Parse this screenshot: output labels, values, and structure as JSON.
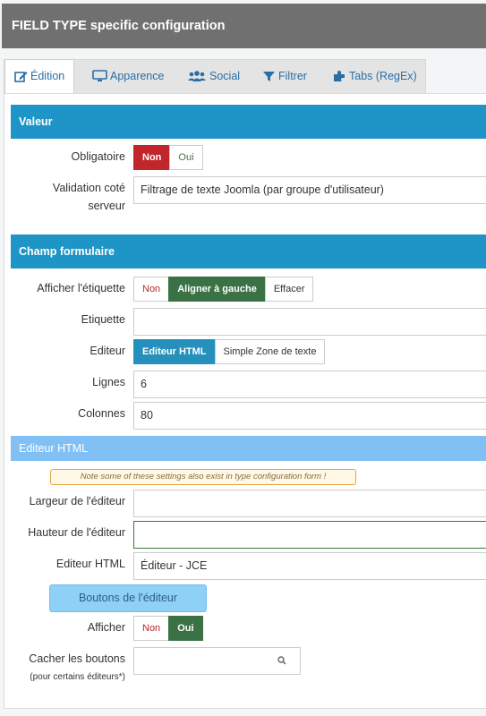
{
  "header": {
    "title": "FIELD TYPE specific configuration"
  },
  "tabs": [
    {
      "label": "Édition",
      "icon": "edit-icon",
      "active": true
    },
    {
      "label": "Apparence",
      "icon": "monitor-icon"
    },
    {
      "label": "Social",
      "icon": "users-icon"
    },
    {
      "label": "Filtrer",
      "icon": "filter-icon"
    },
    {
      "label": "Tabs (RegEx)",
      "icon": "puzzle-icon"
    }
  ],
  "valeur": {
    "title": "Valeur",
    "obligatoire": {
      "label": "Obligatoire",
      "options": [
        "Non",
        "Oui"
      ],
      "selected": "Non"
    },
    "validation": {
      "label_line1": "Validation coté",
      "label_line2": "serveur",
      "value": "Filtrage de texte Joomla (par groupe d'utilisateur)"
    }
  },
  "champ": {
    "title": "Champ formulaire",
    "afficher_etiquette": {
      "label": "Afficher l'étiquette",
      "options": [
        "Non",
        "Aligner à gauche",
        "Effacer"
      ],
      "selected": "Aligner à gauche"
    },
    "etiquette": {
      "label": "Etiquette",
      "value": ""
    },
    "editeur": {
      "label": "Editeur",
      "options": [
        "Editeur HTML",
        "Simple Zone de texte"
      ],
      "selected": "Editeur HTML"
    },
    "lignes": {
      "label": "Lignes",
      "value": "6"
    },
    "colonnes": {
      "label": "Colonnes",
      "value": "80"
    }
  },
  "editeur_html": {
    "title": "Editeur HTML",
    "note": "Note some of these settings also exist in type configuration form !",
    "largeur": {
      "label": "Largeur de l'éditeur",
      "value": ""
    },
    "hauteur": {
      "label": "Hauteur de l'éditeur",
      "value": ""
    },
    "editeur": {
      "label": "Editeur HTML",
      "value": "Éditeur - JCE"
    },
    "boutons_label": "Boutons de l'éditeur",
    "afficher": {
      "label": "Afficher",
      "options": [
        "Non",
        "Oui"
      ],
      "selected": "Oui"
    },
    "cacher": {
      "label": "Cacher les boutons",
      "sublabel": "(pour certains éditeurs*)"
    }
  },
  "colors": {
    "section": "#1e95c6",
    "subsection": "#80c0f4",
    "header": "#707070",
    "red": "#c1262b",
    "green": "#3a7246",
    "blue": "#2490bb"
  }
}
